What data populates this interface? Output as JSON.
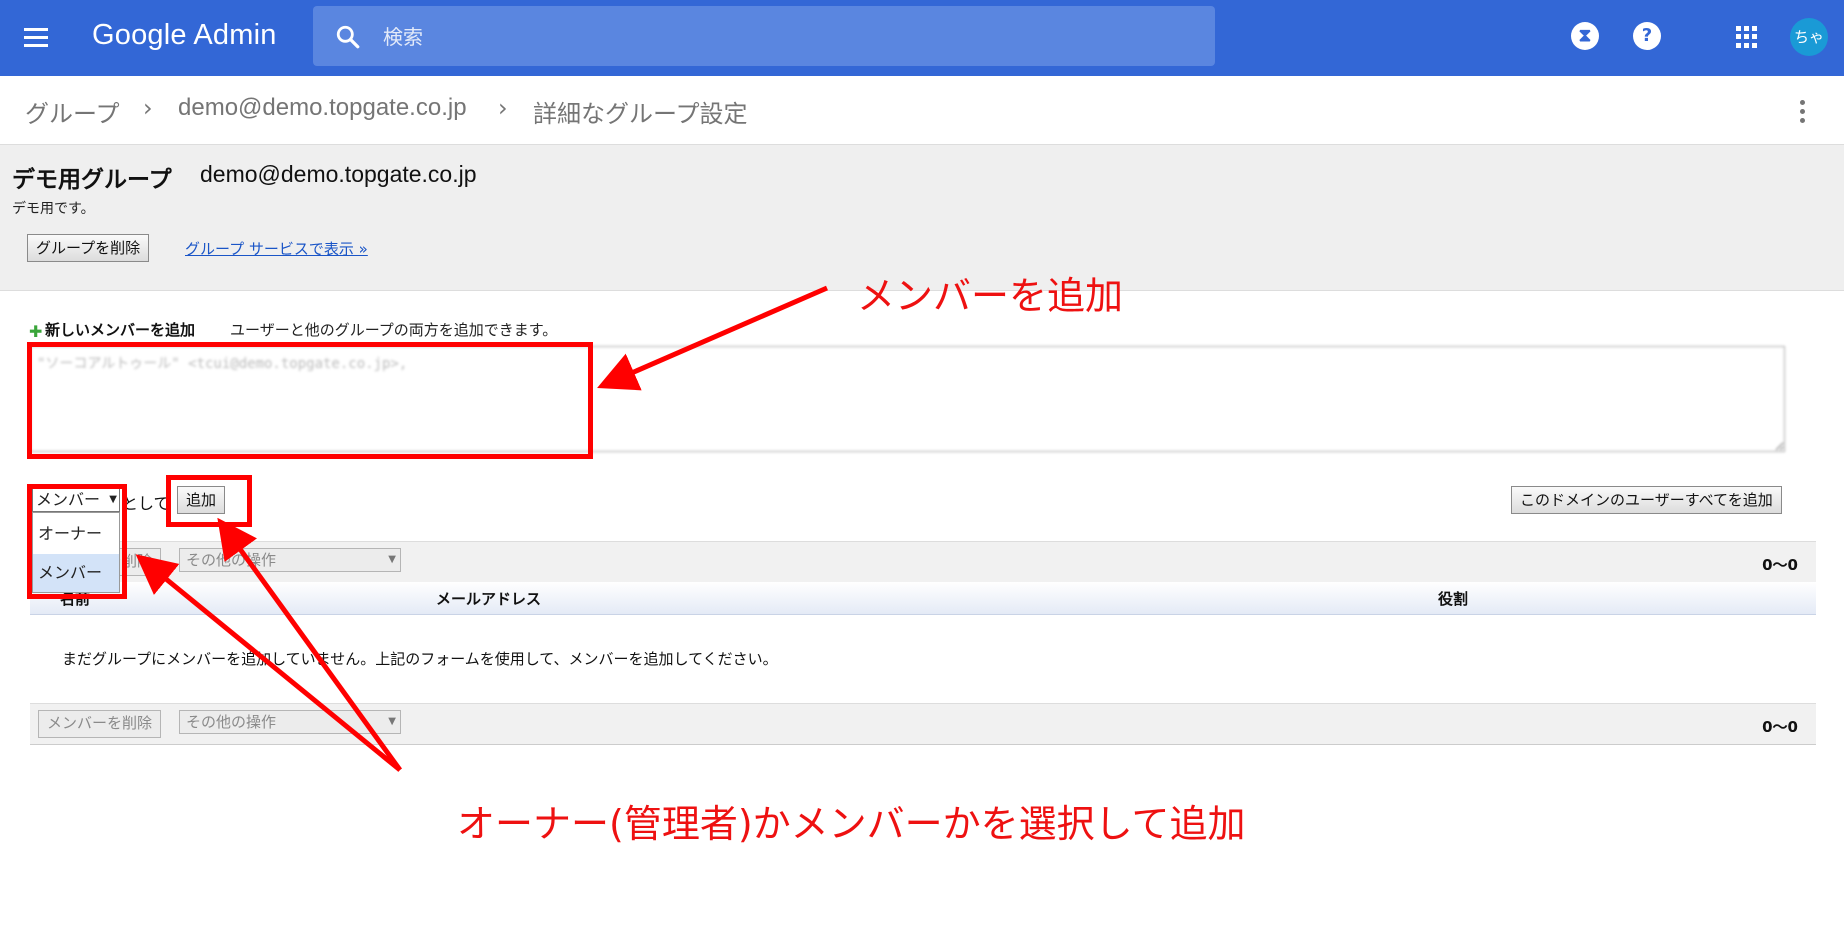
{
  "header": {
    "logo": "Google Admin",
    "search_placeholder": "検索",
    "icons": [
      "menu-icon",
      "search-icon",
      "hourglass-icon",
      "help-icon",
      "apps-icon"
    ],
    "avatar_text": "ちゃ",
    "brand_color": "#3367d6"
  },
  "breadcrumb": {
    "items": [
      "グループ",
      "demo@demo.topgate.co.jp",
      "詳細なグループ設定"
    ],
    "separator": "›"
  },
  "group": {
    "name": "デモ用グループ",
    "email": "demo@demo.topgate.co.jp",
    "description": "デモ用です。",
    "delete_button": "グループを削除",
    "view_link": "グループ サービスで表示 »"
  },
  "add_members": {
    "title": "新しいメンバーを追加",
    "hint": "ユーザーと他のグループの両方を追加できます。",
    "textarea_value": "\"ソーコアルトゥール\" <tcui@demo.topgate.co.jp>,",
    "role_selected": "メンバー",
    "as_label": "として",
    "add_button": "追加",
    "add_all_button": "このドメインのユーザーすべてを追加",
    "role_options": [
      "オーナー",
      "メンバー"
    ]
  },
  "table": {
    "delete_button": "メンバーを削除",
    "other_actions": "その他の操作",
    "count": "0〜0",
    "columns": [
      "名前",
      "メールアドレス",
      "役割"
    ],
    "empty_message": "まだグループにメンバーを追加していません。上記のフォームを使用して、メンバーを追加してください。"
  },
  "annotations": {
    "add_member_label": "メンバーを追加",
    "select_role_label": "オーナー(管理者)かメンバーかを選択して追加",
    "color": "#ff0000"
  }
}
